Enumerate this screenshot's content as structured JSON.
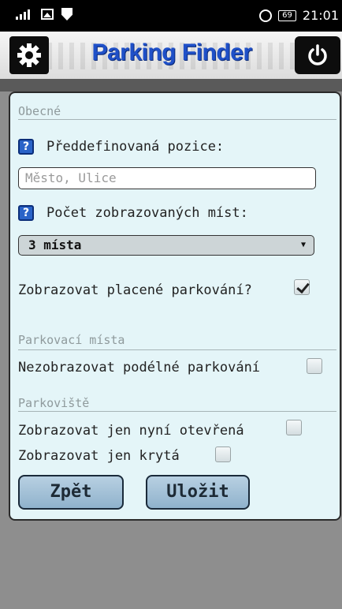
{
  "status_bar": {
    "time": "21:01",
    "battery": "69"
  },
  "header": {
    "title": "Parking Finder"
  },
  "general": {
    "section_title": "Obecné",
    "predefined_position_label": "Předdefinovaná pozice:",
    "position_placeholder": "Město, Ulice",
    "count_label": "Počet zobrazovaných míst:",
    "count_value": "3 místa",
    "paid_parking_label": "Zobrazovat placené parkování?",
    "paid_parking_checked": true
  },
  "parking_spots": {
    "section_title": "Parkovací místa",
    "hide_parallel_label": "Nezobrazovat podélné parkování",
    "hide_parallel_checked": false
  },
  "parking_lots": {
    "section_title": "Parkoviště",
    "open_now_label": "Zobrazovat jen nyní otevřená",
    "open_now_checked": false,
    "covered_only_label": "Zobrazovat jen krytá",
    "covered_only_checked": false
  },
  "buttons": {
    "back": "Zpět",
    "save": "Uložit"
  }
}
